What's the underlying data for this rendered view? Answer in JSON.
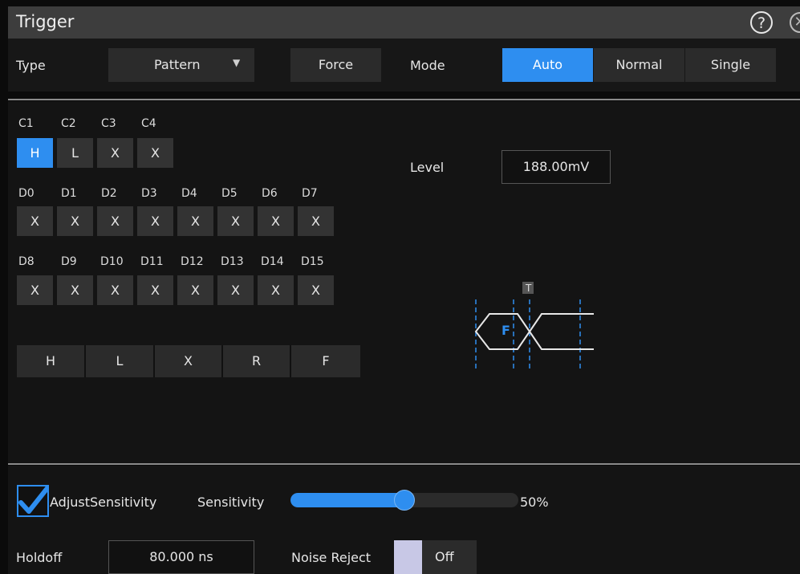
{
  "window": {
    "title": "Trigger"
  },
  "topbar": {
    "type_label": "Type",
    "type_value": "Pattern",
    "force_label": "Force",
    "mode_label": "Mode",
    "modes": [
      "Auto",
      "Normal",
      "Single"
    ],
    "active_mode": "Auto"
  },
  "analog": {
    "labels": [
      "C1",
      "C2",
      "C3",
      "C4"
    ],
    "values": [
      "H",
      "L",
      "X",
      "X"
    ]
  },
  "digital_row1": {
    "labels": [
      "D0",
      "D1",
      "D2",
      "D3",
      "D4",
      "D5",
      "D6",
      "D7"
    ],
    "values": [
      "X",
      "X",
      "X",
      "X",
      "X",
      "X",
      "X",
      "X"
    ]
  },
  "digital_row2": {
    "labels": [
      "D8",
      "D9",
      "D10",
      "D11",
      "D12",
      "D13",
      "D14",
      "D15"
    ],
    "values": [
      "X",
      "X",
      "X",
      "X",
      "X",
      "X",
      "X",
      "X"
    ]
  },
  "pattern_buttons": [
    "H",
    "L",
    "X",
    "R",
    "F"
  ],
  "level": {
    "label": "Level",
    "value": "188.00mV"
  },
  "diagram": {
    "trigger_marker": "T",
    "edge_label": "F"
  },
  "sensitivity": {
    "checkbox_label": "AdjustSensitivity",
    "checked": true,
    "label": "Sensitivity",
    "value_text": "50%",
    "percent": 50
  },
  "holdoff": {
    "label": "Holdoff",
    "value": "80.000 ns"
  },
  "noise_reject": {
    "label": "Noise Reject",
    "state": "Off"
  },
  "colors": {
    "accent": "#2e8ef0",
    "panel": "#2b2b2b",
    "background": "#141414"
  }
}
